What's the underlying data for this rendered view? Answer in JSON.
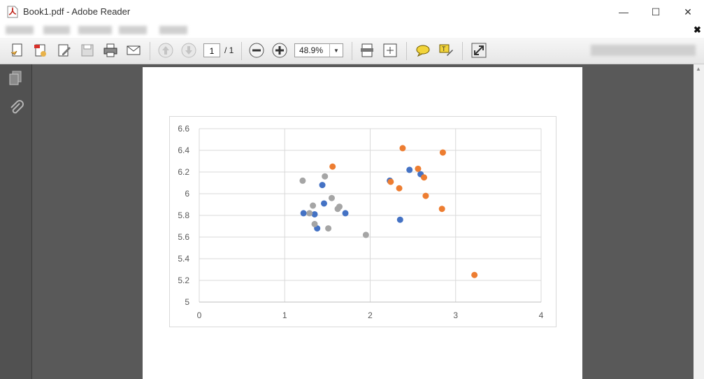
{
  "window": {
    "title": "Book1.pdf - Adobe Reader",
    "minimize": "—",
    "maximize": "☐",
    "close": "✕",
    "doc_close": "✖"
  },
  "toolbar": {
    "page_current": "1",
    "page_total": "/ 1",
    "zoom": "48.9%",
    "icons": [
      "create-pdf-icon",
      "export-pdf-icon",
      "edit-icon",
      "save-icon",
      "print-icon",
      "email-icon",
      "page-up-icon",
      "page-down-icon",
      "zoom-out-icon",
      "zoom-in-icon",
      "fit-page-icon",
      "fit-width-icon",
      "comment-icon",
      "highlight-icon",
      "fullscreen-icon"
    ]
  },
  "nav": {
    "icons": [
      "pages-icon",
      "attachments-icon"
    ]
  },
  "colors": {
    "series_blue": "#4472c4",
    "series_orange": "#ed7d31",
    "series_gray": "#a5a5a5",
    "doc_background": "#595959",
    "nav_background": "#515151"
  },
  "chart_data": {
    "type": "scatter",
    "title": "",
    "xlabel": "",
    "ylabel": "",
    "xlim": [
      0,
      4
    ],
    "ylim": [
      5,
      6.6
    ],
    "x_ticks": [
      "0",
      "1",
      "2",
      "3",
      "4"
    ],
    "y_ticks": [
      "5",
      "5.2",
      "5.4",
      "5.6",
      "5.8",
      "6",
      "6.2",
      "6.4",
      "6.6"
    ],
    "grid": true,
    "legend": "none",
    "series": [
      {
        "color": "#4472c4",
        "points": [
          [
            1.22,
            5.82
          ],
          [
            1.35,
            5.81
          ],
          [
            1.38,
            5.68
          ],
          [
            1.44,
            6.08
          ],
          [
            1.46,
            5.91
          ],
          [
            1.71,
            5.82
          ],
          [
            2.23,
            6.12
          ],
          [
            2.35,
            5.76
          ],
          [
            2.46,
            6.22
          ],
          [
            2.59,
            6.18
          ]
        ]
      },
      {
        "color": "#ed7d31",
        "points": [
          [
            1.56,
            6.25
          ],
          [
            2.24,
            6.11
          ],
          [
            2.34,
            6.05
          ],
          [
            2.38,
            6.42
          ],
          [
            2.56,
            6.23
          ],
          [
            2.63,
            6.15
          ],
          [
            2.65,
            5.98
          ],
          [
            2.84,
            5.86
          ],
          [
            2.85,
            6.38
          ],
          [
            3.22,
            5.25
          ]
        ]
      },
      {
        "color": "#a5a5a5",
        "points": [
          [
            1.21,
            6.12
          ],
          [
            1.29,
            5.82
          ],
          [
            1.33,
            5.89
          ],
          [
            1.35,
            5.72
          ],
          [
            1.47,
            6.16
          ],
          [
            1.51,
            5.68
          ],
          [
            1.55,
            5.96
          ],
          [
            1.62,
            5.86
          ],
          [
            1.64,
            5.88
          ],
          [
            1.95,
            5.62
          ]
        ]
      }
    ]
  }
}
